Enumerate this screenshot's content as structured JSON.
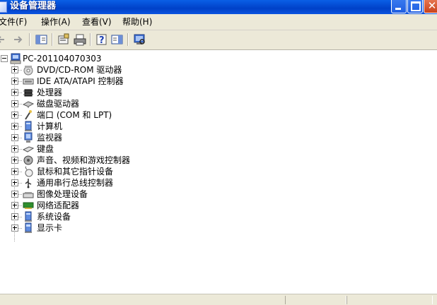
{
  "window": {
    "title": "设备管理器"
  },
  "menu": [
    "文件(F)",
    "操作(A)",
    "查看(V)",
    "帮助(H)"
  ],
  "toolbar": {
    "buttons": [
      "back-arrow-icon",
      "forward-arrow-icon",
      "show-hide-console-tree-icon",
      "properties-icon",
      "print-icon",
      "help-icon",
      "show-hide-action-pane-icon",
      "scan-hardware-icon"
    ]
  },
  "tree": {
    "root": "PC-201104070303",
    "items": [
      {
        "label": "DVD/CD-ROM 驱动器",
        "icon": "cdrom-icon"
      },
      {
        "label": "IDE ATA/ATAPI 控制器",
        "icon": "ide-controller-icon"
      },
      {
        "label": "处理器",
        "icon": "processor-icon"
      },
      {
        "label": "磁盘驱动器",
        "icon": "disk-drive-icon"
      },
      {
        "label": "端口 (COM 和 LPT)",
        "icon": "port-icon"
      },
      {
        "label": "计算机",
        "icon": "computer-icon"
      },
      {
        "label": "监视器",
        "icon": "monitor-icon"
      },
      {
        "label": "键盘",
        "icon": "keyboard-icon"
      },
      {
        "label": "声音、视频和游戏控制器",
        "icon": "sound-icon"
      },
      {
        "label": "鼠标和其它指针设备",
        "icon": "mouse-icon"
      },
      {
        "label": "通用串行总线控制器",
        "icon": "usb-icon"
      },
      {
        "label": "图像处理设备",
        "icon": "imaging-icon"
      },
      {
        "label": "网络适配器",
        "icon": "network-adapter-icon"
      },
      {
        "label": "系统设备",
        "icon": "system-device-icon"
      },
      {
        "label": "显示卡",
        "icon": "display-adapter-icon"
      }
    ]
  }
}
